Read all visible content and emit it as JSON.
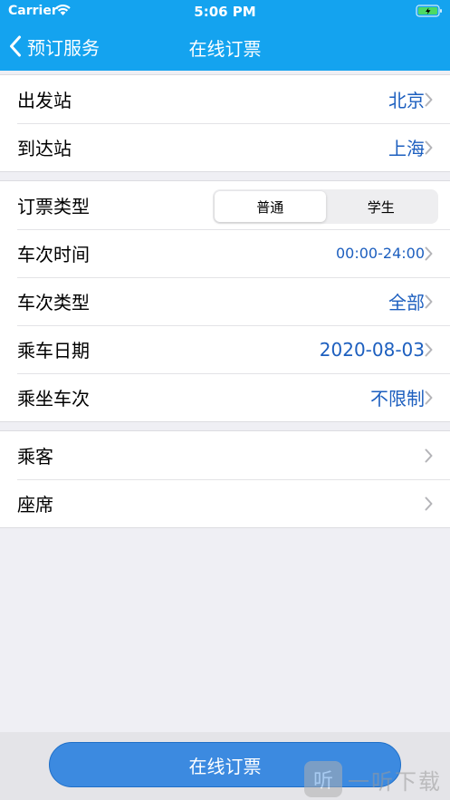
{
  "status_bar": {
    "carrier": "Carrier",
    "time": "5:06 PM"
  },
  "nav": {
    "back_label": "预订服务",
    "title": "在线订票"
  },
  "station_group": [
    {
      "label": "出发站",
      "value": "北京"
    },
    {
      "label": "到达站",
      "value": "上海"
    }
  ],
  "options_group": {
    "ticket_type": {
      "label": "订票类型",
      "options": [
        "普通",
        "学生"
      ],
      "selected": "普通"
    },
    "rows": [
      {
        "label": "车次时间",
        "value": "00:00-24:00"
      },
      {
        "label": "车次类型",
        "value": "全部"
      },
      {
        "label": "乘车日期",
        "value": "2020-08-03"
      },
      {
        "label": "乘坐车次",
        "value": "不限制"
      }
    ]
  },
  "passenger_group": [
    {
      "label": "乘客",
      "value": ""
    },
    {
      "label": "座席",
      "value": ""
    }
  ],
  "submit_label": "在线订票",
  "watermark": {
    "logo_text": "听",
    "text": "一听下载"
  },
  "colors": {
    "header": "#14a3ef",
    "value_text": "#1d5fbf",
    "button": "#3c8ae0"
  }
}
